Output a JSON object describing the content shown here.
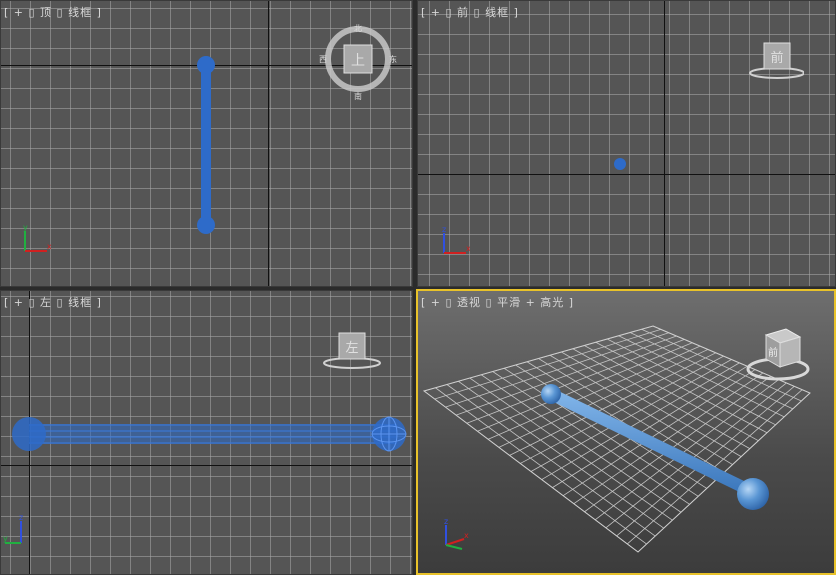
{
  "viewports": {
    "top": {
      "label": "[ + ▯ 顶 ▯ 线框 ]",
      "cube_face": "上",
      "compass": {
        "n": "北",
        "s": "南",
        "e": "东",
        "w": "西"
      }
    },
    "front": {
      "label": "[ + ▯ 前 ▯ 线框 ]",
      "cube_face": "前"
    },
    "left": {
      "label": "[ + ▯ 左 ▯ 线框 ]",
      "cube_face": "左"
    },
    "persp": {
      "label": "[ + ▯ 透视 ▯ 平滑 + 高光 ]",
      "cube_face": "前"
    }
  },
  "triad": {
    "x": "x",
    "y": "y",
    "z": "z"
  },
  "colors": {
    "viewport_bg": "#555555",
    "active_border": "#e8c22a",
    "object_blue": "#2e6bc9",
    "object_light_blue": "#4d8fcf",
    "axis_x": "#d02020",
    "axis_y": "#20b040",
    "axis_z": "#3050e0"
  }
}
